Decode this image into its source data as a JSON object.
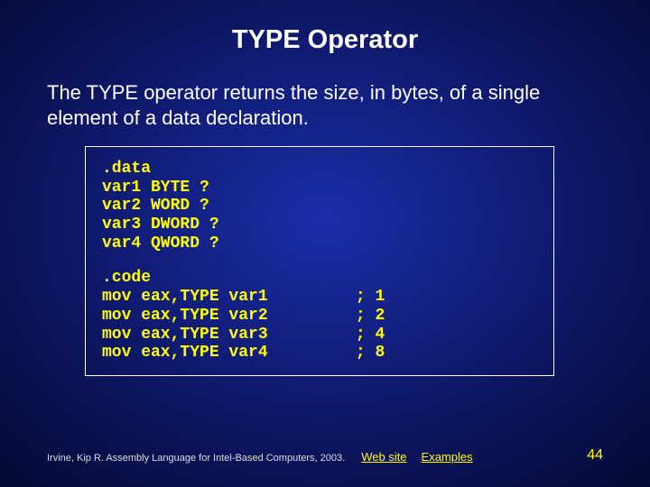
{
  "title": "TYPE Operator",
  "description": "The TYPE operator returns the size, in bytes, of a single element of a data declaration.",
  "code_data": ".data\nvar1 BYTE ?\nvar2 WORD ?\nvar3 DWORD ?\nvar4 QWORD ?",
  "code_code": ".code\nmov eax,TYPE var1         ; 1\nmov eax,TYPE var2         ; 2\nmov eax,TYPE var3         ; 4\nmov eax,TYPE var4         ; 8",
  "footer": {
    "credit": "Irvine, Kip R. Assembly Language for Intel-Based Computers, 2003.",
    "link_web": "Web site",
    "link_examples": "Examples",
    "page": "44"
  }
}
